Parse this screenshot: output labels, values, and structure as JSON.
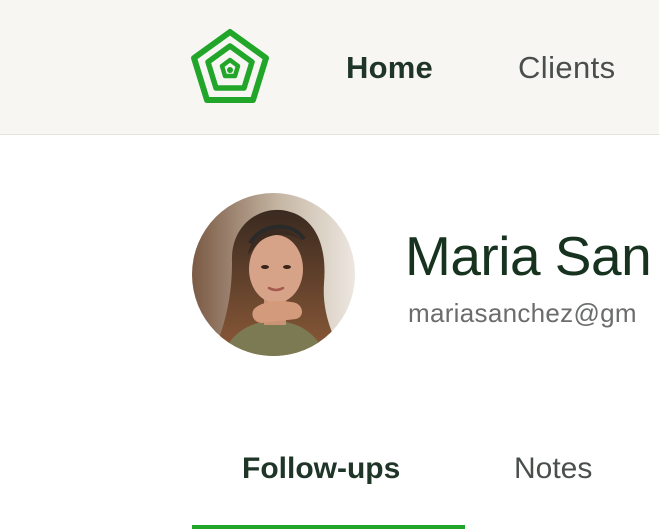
{
  "brand": {
    "logo_icon": "house-pentagon-icon",
    "accent_color": "#22a62a"
  },
  "nav": {
    "items": [
      {
        "label": "Home",
        "active": true
      },
      {
        "label": "Clients",
        "active": false
      }
    ]
  },
  "profile": {
    "name": "Maria San",
    "email": "mariasanchez@gm",
    "avatar_icon": "avatar-photo"
  },
  "tabs": {
    "items": [
      {
        "label": "Follow-ups",
        "active": true
      },
      {
        "label": "Notes",
        "active": false
      }
    ]
  }
}
